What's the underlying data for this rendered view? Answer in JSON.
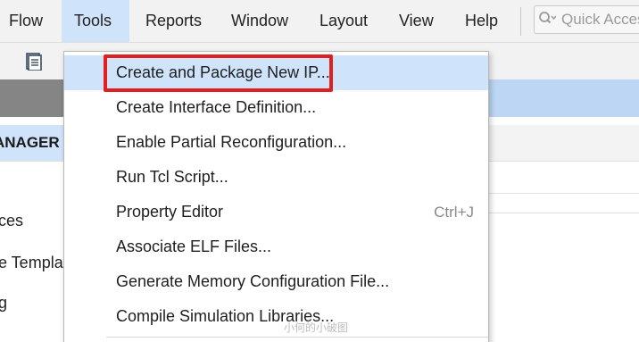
{
  "menubar": {
    "items": [
      {
        "label": "Flow",
        "active": false
      },
      {
        "label": "Tools",
        "active": true
      },
      {
        "label": "Reports",
        "active": false
      },
      {
        "label": "Window",
        "active": false
      },
      {
        "label": "Layout",
        "active": false
      },
      {
        "label": "View",
        "active": false
      },
      {
        "label": "Help",
        "active": false
      }
    ],
    "quick_access_placeholder": "Quick Access"
  },
  "toolbar": {
    "icons": [
      "document-icon"
    ]
  },
  "background": {
    "manager_title": "ANAGER",
    "left_items": [
      "ces",
      "e Templat",
      "g"
    ]
  },
  "tools_menu": {
    "items": [
      {
        "label": "Create and Package New IP...",
        "shortcut": "",
        "highlighted": true
      },
      {
        "label": "Create Interface Definition...",
        "shortcut": "",
        "highlighted": false
      },
      {
        "label": "Enable Partial Reconfiguration...",
        "shortcut": "",
        "highlighted": false
      },
      {
        "label": "Run Tcl Script...",
        "shortcut": "",
        "highlighted": false
      },
      {
        "label": "Property Editor",
        "shortcut": "Ctrl+J",
        "highlighted": false
      },
      {
        "label": "Associate ELF Files...",
        "shortcut": "",
        "highlighted": false
      },
      {
        "label": "Generate Memory Configuration File...",
        "shortcut": "",
        "highlighted": false
      },
      {
        "label": "Compile Simulation Libraries...",
        "shortcut": "",
        "highlighted": false
      }
    ]
  },
  "annotation": {
    "highlight_color": "#e0201e"
  },
  "watermark": "小何的小破图",
  "colors": {
    "menu_highlight": "#cfe3fb",
    "menubar_bg": "#f2f2f2",
    "header_dark": "#858585"
  }
}
